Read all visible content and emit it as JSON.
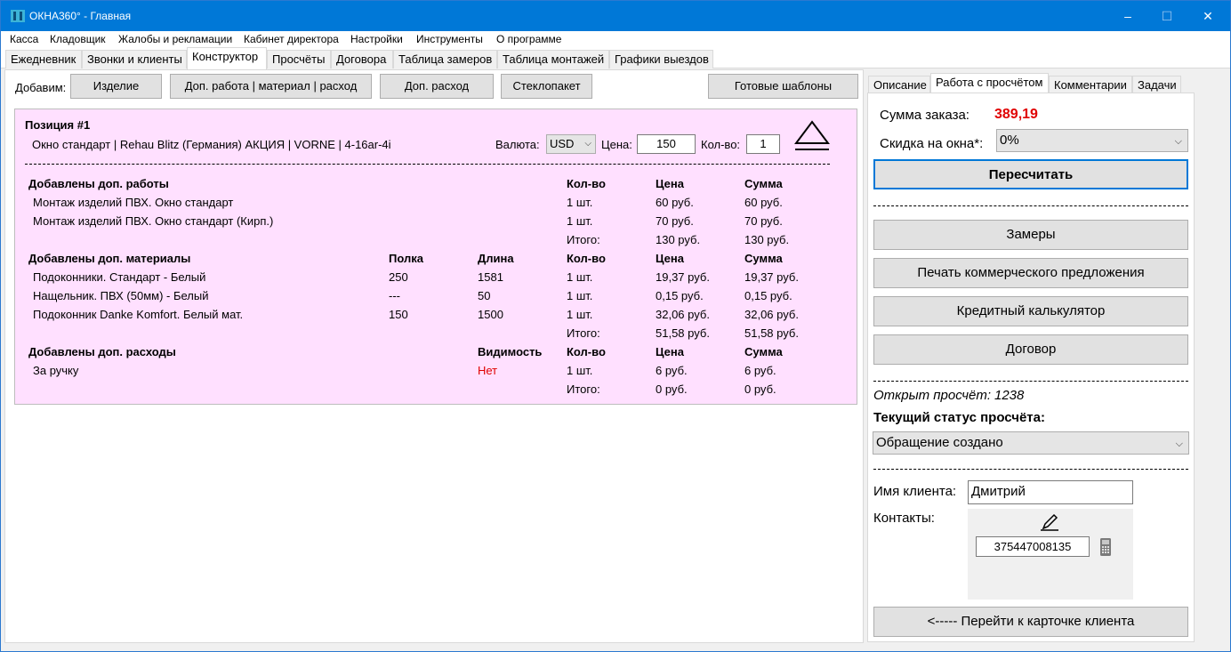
{
  "window": {
    "title": "ОКНА360° - Главная",
    "minimize": "–",
    "maximize": "☐",
    "close": "✕"
  },
  "menu": [
    "Касса",
    "Кладовщик",
    "Жалобы и рекламации",
    "Кабинет директора",
    "Настройки",
    "Инструменты",
    "О программе"
  ],
  "tabs": [
    "Ежедневник",
    "Звонки и клиенты",
    "Конструктор",
    "Просчёты",
    "Договора",
    "Таблица замеров",
    "Таблица монтажей",
    "Графики выездов"
  ],
  "active_tab": "Конструктор",
  "toolbar": {
    "label": "Добавим:",
    "buttons": [
      "Изделие",
      "Доп. работа | материал | расход",
      "Доп. расход",
      "Стеклопакет",
      "Готовые шаблоны"
    ]
  },
  "position": {
    "title": "Позиция #1",
    "product": "Окно стандарт | Rehau Blitz (Германия) АКЦИЯ | VORNE | 4-16ar-4i",
    "currency_label": "Валюта:",
    "currency": "USD",
    "price_label": "Цена:",
    "price": "150",
    "qty_label": "Кол-во:",
    "qty": "1",
    "eject_icon": "eject-icon",
    "works": {
      "header": "Добавлены доп. работы",
      "cols": [
        "Кол-во",
        "Цена",
        "Сумма"
      ],
      "rows": [
        [
          "Монтаж изделий ПВХ. Окно стандарт",
          "1 шт.",
          "60 руб.",
          "60 руб."
        ],
        [
          "Монтаж изделий ПВХ. Окно стандарт (Кирп.)",
          "1 шт.",
          "70 руб.",
          "70 руб."
        ]
      ],
      "total": [
        "Итого:",
        "130 руб.",
        "130 руб."
      ]
    },
    "materials": {
      "header": "Добавлены доп. материалы",
      "cols": [
        "Полка",
        "Длина",
        "Кол-во",
        "Цена",
        "Сумма"
      ],
      "rows": [
        [
          "Подоконники. Стандарт - Белый",
          "250",
          "1581",
          "1 шт.",
          "19,37 руб.",
          "19,37 руб."
        ],
        [
          "Нащельник. ПВХ (50мм) - Белый",
          "---",
          "50",
          "1 шт.",
          "0,15 руб.",
          "0,15 руб."
        ],
        [
          "Подоконник Danke Komfort. Белый мат.",
          "150",
          "1500",
          "1 шт.",
          "32,06 руб.",
          "32,06 руб."
        ]
      ],
      "total": [
        "Итого:",
        "51,58 руб.",
        "51,58 руб."
      ]
    },
    "expenses": {
      "header": "Добавлены доп. расходы",
      "cols": [
        "Видимость",
        "Кол-во",
        "Цена",
        "Сумма"
      ],
      "rows": [
        [
          "За ручку",
          "Нет",
          "1 шт.",
          "6 руб.",
          "6 руб."
        ]
      ],
      "total": [
        "Итого:",
        "0 руб.",
        "0 руб."
      ]
    }
  },
  "right_tabs": [
    "Описание",
    "Работа с просчётом",
    "Комментарии",
    "Задачи"
  ],
  "right": {
    "sum_label": "Сумма заказа:",
    "sum_value": "389,19",
    "discount_label": "Скидка на окна*:",
    "discount_value": "0%",
    "recalc": "Пересчитать",
    "buttons": [
      "Замеры",
      "Печать коммерческого предложения",
      "Кредитный калькулятор",
      "Договор"
    ],
    "opened_label": "Открыт просчёт:",
    "opened_value": "1238",
    "status_label": "Текущий статус просчёта:",
    "status_value": "Обращение создано",
    "client_label": "Имя клиента:",
    "client_value": "Дмитрий",
    "contacts_label": "Контакты:",
    "phone": "375447008135",
    "edit_icon": "edit-icon",
    "phone_icon": "phone-icon",
    "go_card": "<----- Перейти к карточке клиента"
  },
  "colors": {
    "titlebar": "#0078d7",
    "panel_bg": "#ffe0ff",
    "accent_red": "#e00000"
  }
}
